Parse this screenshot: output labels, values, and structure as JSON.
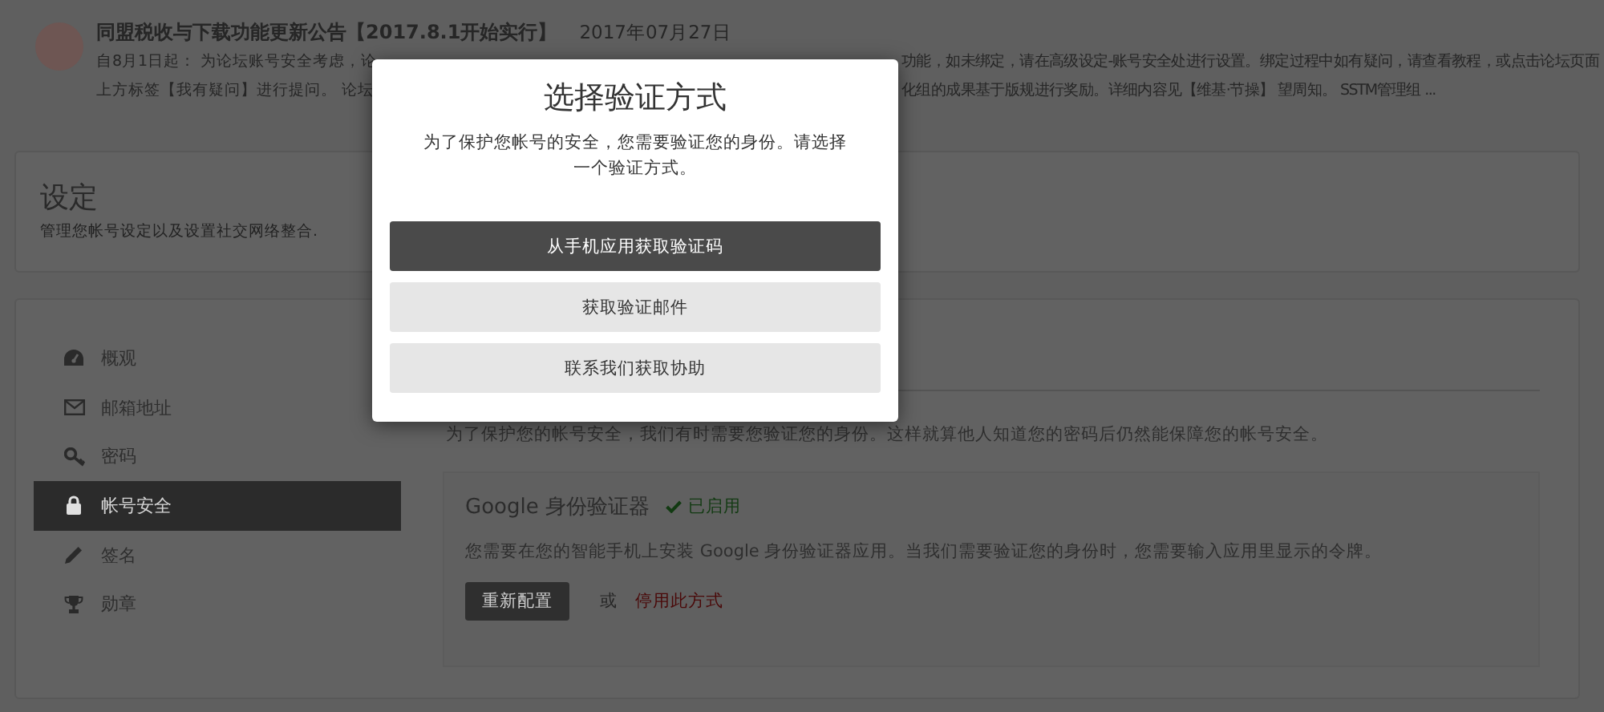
{
  "announcement": {
    "title": "同盟税收与下载功能更新公告【2017.8.1开始实行】",
    "date": "2017年07月27日",
    "lines": [
      {
        "left": "自8月1日起： 为论坛账号安全考虑，论",
        "right": "功能，如未绑定，请在高级设定-账号安全处进行设置。绑定过程中如有疑问，请查看教程，或点击论坛页面"
      },
      {
        "left": "上方标签【我有疑问】进行提问。 论坛",
        "right": "化组的成果基于版规进行奖励。详细内容见【维基·节操】 望周知。 SSTM管理组 ..."
      }
    ]
  },
  "settings_header": {
    "title": "设定",
    "description": "管理您帐号设定以及设置社交网络整合."
  },
  "sidebar": {
    "items": [
      {
        "label": "概观",
        "selected": false
      },
      {
        "label": "邮箱地址",
        "selected": false
      },
      {
        "label": "密码",
        "selected": false
      },
      {
        "label": "帐号安全",
        "selected": true
      },
      {
        "label": "签名",
        "selected": false
      },
      {
        "label": "勋章",
        "selected": false
      }
    ]
  },
  "security": {
    "intro": "为了保护您的帐号安全，我们有时需要您验证您的身份。这样就算他人知道您的密码后仍然能保障您的帐号安全。",
    "google_auth": {
      "title": "Google 身份验证器",
      "status": "已启用",
      "description": "您需要在您的智能手机上安装 Google 身份验证器应用。当我们需要验证您的身份时，您需要输入应用里显示的令牌。",
      "reconfigure_button": "重新配置",
      "or_text": "或",
      "disable_link": "停用此方式"
    }
  },
  "modal": {
    "title": "选择验证方式",
    "description": "为了保护您帐号的安全，您需要验证您的身份。请选择一个验证方式。",
    "options": [
      {
        "label": "从手机应用获取验证码",
        "selected": true
      },
      {
        "label": "获取验证邮件",
        "selected": false
      },
      {
        "label": "联系我们获取协助",
        "selected": false
      }
    ]
  }
}
